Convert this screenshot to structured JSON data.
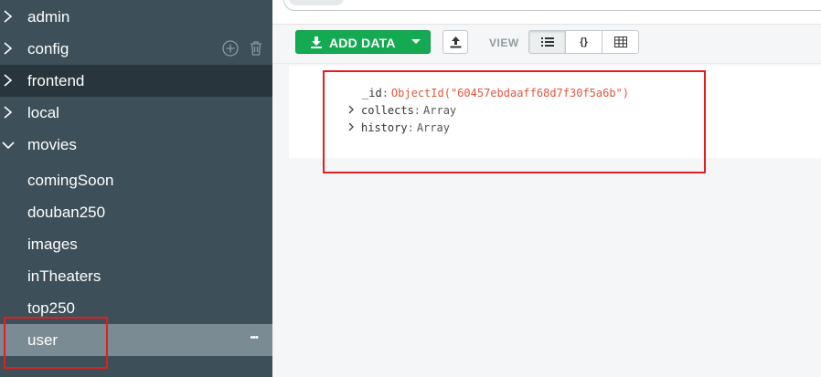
{
  "sidebar": {
    "databases": [
      {
        "name": "admin"
      },
      {
        "name": "config"
      },
      {
        "name": "frontend"
      },
      {
        "name": "local"
      },
      {
        "name": "movies"
      }
    ],
    "collections": [
      {
        "name": "comingSoon"
      },
      {
        "name": "douban250"
      },
      {
        "name": "images"
      },
      {
        "name": "inTheaters"
      },
      {
        "name": "top250"
      },
      {
        "name": "user"
      }
    ],
    "more_label": "•••",
    "icons": {
      "add": "plus-circle-icon",
      "delete": "trash-icon",
      "collapsed": "chevron-right-icon",
      "expanded": "chevron-down-icon"
    }
  },
  "toolbar": {
    "add_data_label": "ADD DATA",
    "view_label": "VIEW",
    "view_modes": [
      "☰",
      "{}",
      "▦"
    ],
    "icons": {
      "add": "download-icon",
      "caret": "caret-down-icon",
      "import": "upload-icon",
      "list": "list-view-icon",
      "json": "json-view-icon",
      "table": "table-view-icon"
    }
  },
  "document": {
    "id_key": "_id",
    "id_value": "ObjectId(\"60457ebdaaff68d7f30f5a6b\")",
    "fields": [
      {
        "key": "collects",
        "type": "Array"
      },
      {
        "key": "history",
        "type": "Array"
      }
    ]
  },
  "colors": {
    "sidebar_bg": "#3d4f58",
    "sidebar_active": "#28353c",
    "sidebar_selected": "#7a8b93",
    "add_button": "#13aa52",
    "objectid": "#e0573d",
    "highlight_box": "#e02020"
  }
}
